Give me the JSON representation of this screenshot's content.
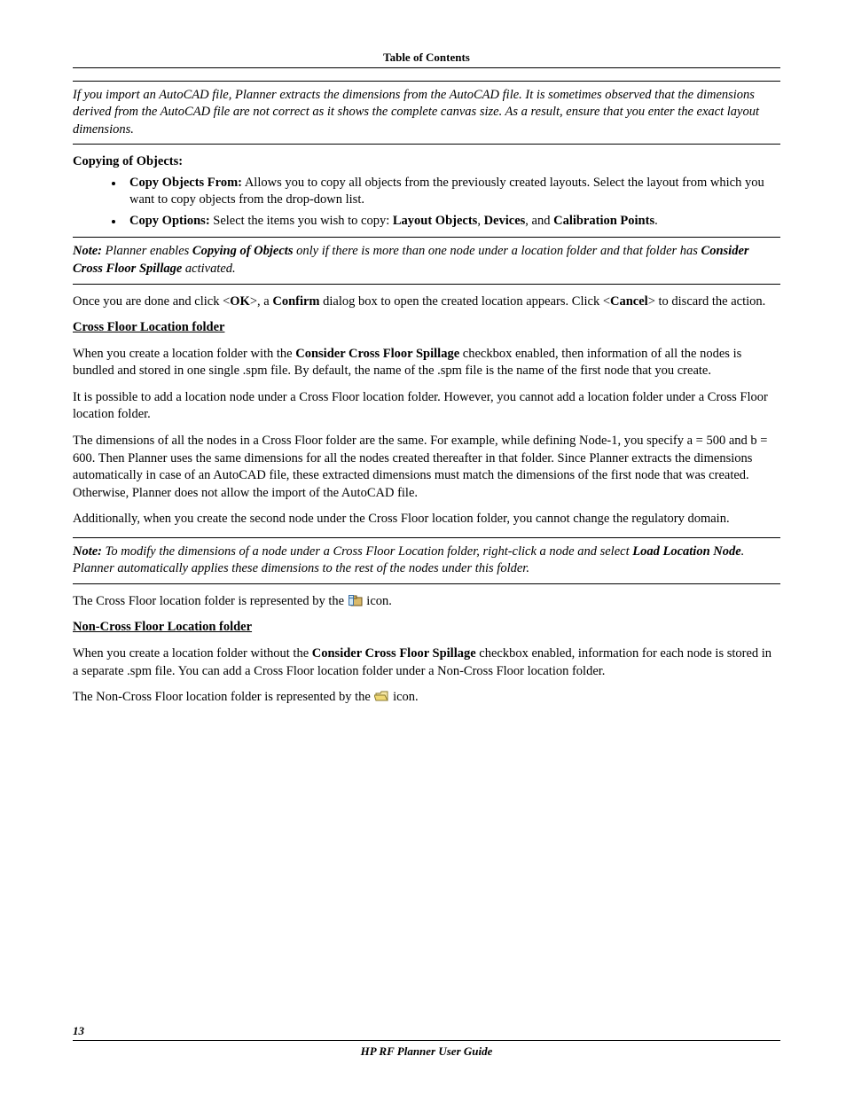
{
  "header": "Table of Contents",
  "note1": {
    "text": "If you import an AutoCAD file, Planner extracts the dimensions from the AutoCAD file. It is sometimes observed that the dimensions derived from the AutoCAD file are not correct as it shows the complete canvas size. As a result, ensure that you enter the exact layout dimensions."
  },
  "copying_head": "Copying of Objects:",
  "bullets": {
    "b1_label": "Copy Objects From:",
    "b1_text": " Allows you to copy all objects from the previously created layouts. Select the layout from which you want to copy objects from the drop-down list.",
    "b2_label": "Copy Options:",
    "b2_pre": " Select the items you wish to copy: ",
    "b2_t1": "Layout Objects",
    "b2_sep1": ", ",
    "b2_t2": "Devices",
    "b2_sep2": ", and ",
    "b2_t3": "Calibration Points",
    "b2_end": "."
  },
  "note2": {
    "lead": "Note:",
    "p1a": " Planner enables ",
    "boldA": "Copying of Objects",
    "p1b": " only if there is more than one node under a location folder and that folder has ",
    "boldB": "Consider Cross Floor Spillage",
    "p1c": " activated."
  },
  "confirm": {
    "a": "Once you are done and click <",
    "ok": "OK",
    "b": ">, a ",
    "confirm": "Confirm",
    "c": " dialog box to open the created location appears. Click <",
    "cancel": "Cancel",
    "d": "> to discard the action."
  },
  "cross_head": "Cross Floor Location folder",
  "cross_p1a": "When you create a location folder with the ",
  "cross_p1b": "Consider Cross Floor Spillage",
  "cross_p1c": " checkbox enabled, then information of all the nodes is bundled and stored in one single .spm file. By default, the name of the .spm file is the name of the first node that you create.",
  "cross_p2": "It is possible to add a location node under a Cross Floor location folder. However, you cannot add a location folder under a Cross Floor location folder.",
  "cross_p3": "The dimensions of all the nodes in a Cross Floor folder are the same. For example, while defining Node-1, you specify a = 500 and b = 600. Then Planner uses the same dimensions for all the nodes created thereafter in that folder. Since Planner extracts the dimensions automatically in case of an AutoCAD file, these extracted dimensions must match the dimensions of the first node that was created. Otherwise, Planner does not allow the import of the AutoCAD file.",
  "cross_p4": "Additionally, when you create the second node under the Cross Floor location folder, you cannot change the regulatory domain.",
  "note3": {
    "lead": "Note:",
    "a": " To modify the dimensions of a node under a Cross Floor Location folder, right-click a node and select ",
    "bold": "Load Location Node",
    "b": ". Planner automatically applies these dimensions to the rest of the nodes under this folder."
  },
  "cross_icon_line_a": "The Cross Floor location folder is represented by the ",
  "cross_icon_line_b": " icon.",
  "noncross_head": "Non-Cross Floor Location folder",
  "noncross_p1a": "When you create a location folder without the ",
  "noncross_p1b": "Consider Cross Floor Spillage",
  "noncross_p1c": " checkbox enabled, information for each node is stored in a separate .spm file. You can add a Cross Floor location folder under a Non-Cross Floor location folder.",
  "noncross_icon_a": "The Non-Cross Floor location folder is represented by the ",
  "noncross_icon_b": " icon.",
  "page_num": "13",
  "doc_title": "HP RF Planner User Guide"
}
